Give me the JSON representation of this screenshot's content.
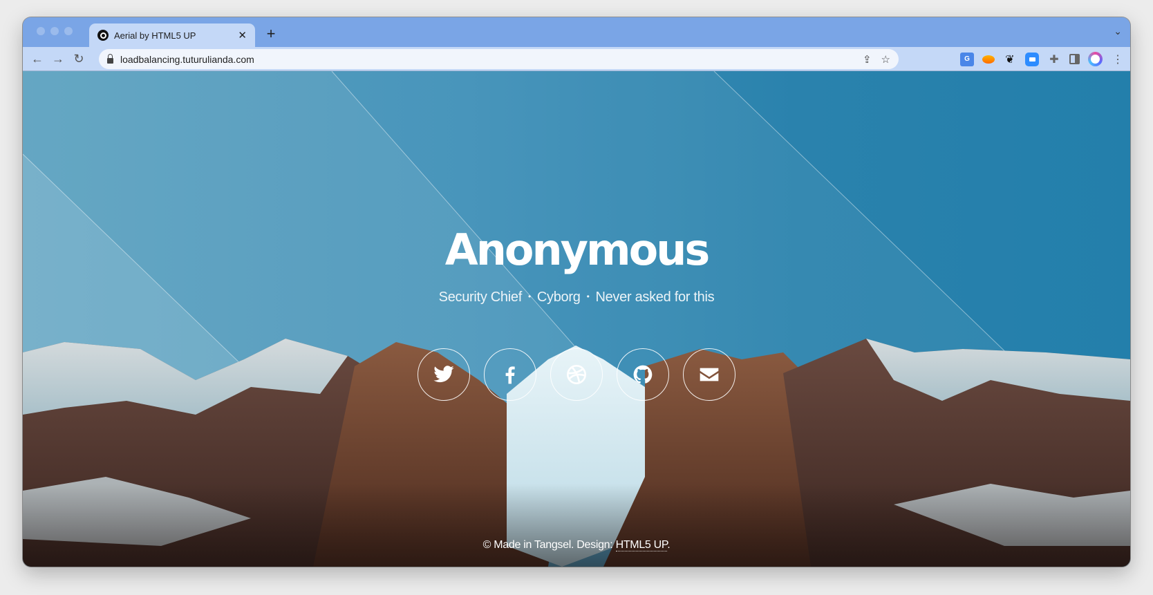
{
  "browser": {
    "tab": {
      "title": "Aerial by HTML5 UP",
      "favicon": "circle-logo-icon"
    },
    "new_tab_label": "+",
    "url": "loadbalancing.tuturulianda.com",
    "nav": {
      "back": "←",
      "forward": "→",
      "reload": "↻"
    },
    "omnibox_icons": {
      "share": "⇪",
      "bookmark": "☆"
    },
    "extensions": [
      "google-translate-icon",
      "orange-extension-icon",
      "gnome-foot-icon",
      "zoom-icon",
      "puzzle-icon",
      "side-panel-icon",
      "profile-avatar-icon"
    ],
    "menu_glyph": "⋮",
    "tab_menu_glyph": "⌄",
    "close_glyph": "✕",
    "puzzle_glyph": "✚",
    "foot_glyph": "❦"
  },
  "hero": {
    "name": "Anonymous",
    "tagline": [
      "Security Chief",
      "Cyborg",
      "Never asked for this"
    ],
    "separator": "•"
  },
  "social": [
    {
      "name": "twitter",
      "icon": "twitter-icon"
    },
    {
      "name": "facebook",
      "icon": "facebook-icon"
    },
    {
      "name": "dribbble",
      "icon": "dribbble-icon"
    },
    {
      "name": "github",
      "icon": "github-icon"
    },
    {
      "name": "email",
      "icon": "envelope-icon"
    }
  ],
  "footer": {
    "text": "© Made in Tangsel. Design: ",
    "link": "HTML5 UP",
    "end": "."
  },
  "colors": {
    "tabstrip": "#7aa5e6",
    "toolbar": "#c4d8f7",
    "sky": "#2f87b2"
  }
}
